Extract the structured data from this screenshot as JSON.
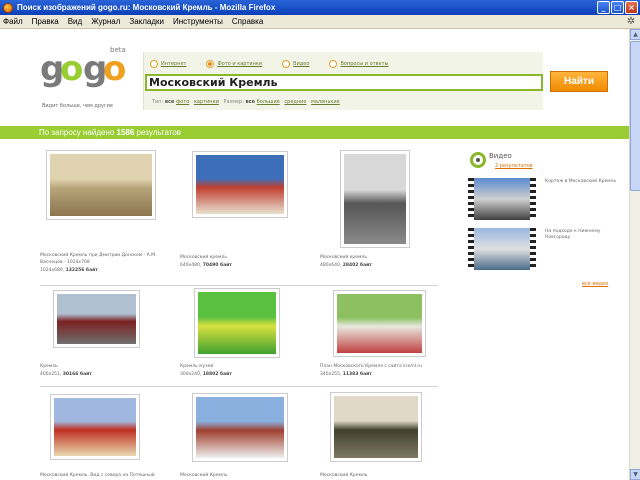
{
  "window": {
    "title": "Поиск изображений gogo.ru: Московский Кремль - Mozilla Firefox"
  },
  "menu": [
    "Файл",
    "Правка",
    "Вид",
    "Журнал",
    "Закладки",
    "Инструменты",
    "Справка"
  ],
  "logo": {
    "text": "gogo",
    "badge": "beta",
    "tagline": "Видит больше, чем другие"
  },
  "tabs": [
    {
      "label": "Интернет",
      "active": false
    },
    {
      "label": "Фото и картинки",
      "active": true
    },
    {
      "label": "Видео",
      "active": false
    },
    {
      "label": "Вопросы и ответы",
      "active": false
    }
  ],
  "search": {
    "value": "Московский Кремль",
    "button": "Найти"
  },
  "filters": {
    "type_label": "Тип:",
    "type_all": "все",
    "type_opts": [
      "фото",
      "картинки"
    ],
    "size_label": "Размер:",
    "size_all": "все",
    "size_opts": [
      "большие",
      "средние",
      "маленькие"
    ]
  },
  "results": {
    "prefix": "По запросу найдено",
    "count": "1586",
    "suffix": "результатов"
  },
  "images": [
    {
      "caption": "Московский Кремль при Дмитрии Донском - А.М. Васнецов - 1024x768",
      "dims": "1024x680,",
      "size": "132256 байт",
      "palette": [
        "#e0d4b0",
        "#b8a57a",
        "#8a7550"
      ]
    },
    {
      "caption": "Московский кремль",
      "dims": "640x480,",
      "size": "70490 байт",
      "palette": [
        "#3d6fb8",
        "#c04030",
        "#e8e0d0"
      ]
    },
    {
      "caption": "Московский кремль",
      "dims": "480x640,",
      "size": "28402 байт",
      "palette": [
        "#d8d8d8",
        "#555555",
        "#8a8a8a"
      ]
    },
    {
      "caption": "Кремль",
      "dims": "400x251,",
      "size": "30166 байт",
      "palette": [
        "#b0c0d0",
        "#7a2020",
        "#707070"
      ]
    },
    {
      "caption": "Кремль музей",
      "dims": "300x240,",
      "size": "18802 байт",
      "palette": [
        "#5ac040",
        "#d8e040",
        "#40a030"
      ]
    },
    {
      "caption": "План Московского Кремля с сайта kreml.ru",
      "dims": "340x255,",
      "size": "11383 байт",
      "palette": [
        "#8cc060",
        "#e8e8e0",
        "#c04040"
      ]
    },
    {
      "caption": "Московский Кремль. Вид с севера на Потешный",
      "dims": "",
      "size": "",
      "palette": [
        "#a0b8e0",
        "#c03020",
        "#e8d8b0"
      ]
    },
    {
      "caption": "Московский Кремль",
      "dims": "",
      "size": "",
      "palette": [
        "#8ab0e0",
        "#a04030",
        "#f0f0f0"
      ]
    },
    {
      "caption": "Московский Кремль",
      "dims": "",
      "size": "",
      "palette": [
        "#e0d8c8",
        "#404030",
        "#807860"
      ]
    }
  ],
  "video": {
    "title": "Видео",
    "count": "2 результатов",
    "items": [
      {
        "caption": "Кортеж в Московский Кремль"
      },
      {
        "caption": "На подходе к Нижнему Новгороду"
      }
    ],
    "more": "все видео"
  }
}
